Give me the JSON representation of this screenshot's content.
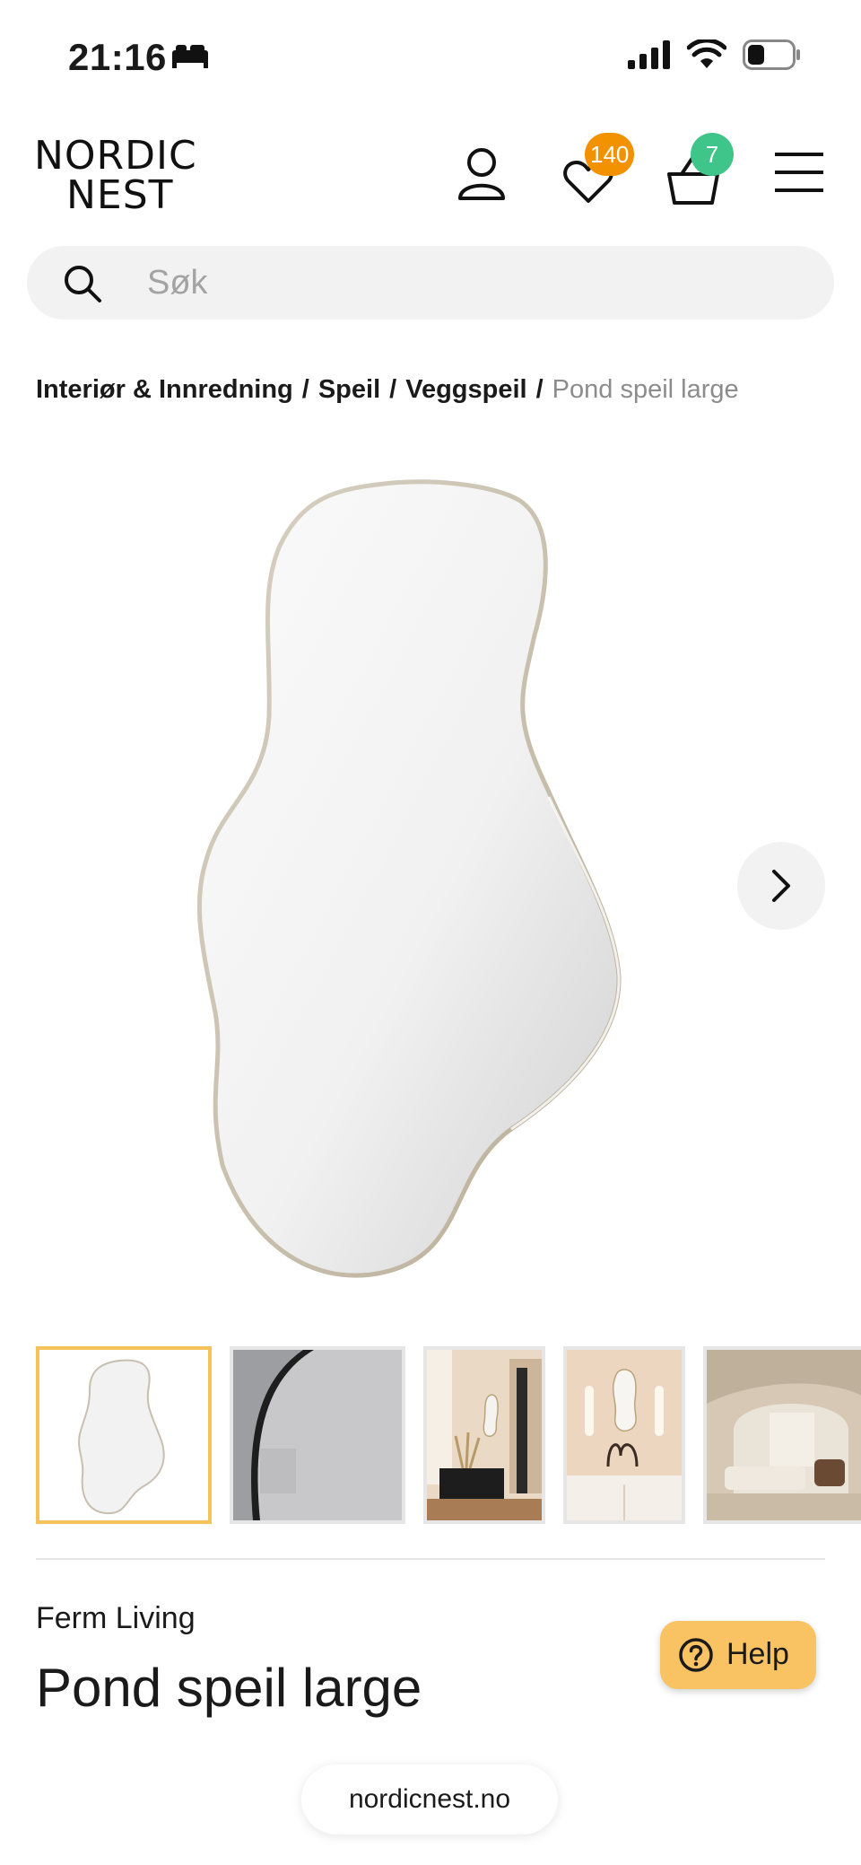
{
  "status_bar": {
    "time": "21:16"
  },
  "header": {
    "logo_line1": "NORDIC",
    "logo_line2": "NEST",
    "wishlist_count": "140",
    "cart_count": "7",
    "icons": [
      "user-icon",
      "heart-icon",
      "basket-icon",
      "menu-icon"
    ],
    "wishlist_badge_color": "#f39200",
    "cart_badge_color": "#3fc489"
  },
  "search": {
    "placeholder": "Søk"
  },
  "breadcrumb": {
    "items": [
      "Interiør & Innredning",
      "Speil",
      "Veggspeil"
    ],
    "separator": "/",
    "current": "Pond speil large"
  },
  "product": {
    "brand": "Ferm Living",
    "title": "Pond speil large",
    "thumbnail_count": 5,
    "active_thumbnail": 1
  },
  "help": {
    "label": "Help"
  },
  "browser": {
    "url": "nordicnest.no"
  },
  "colors": {
    "accent": "#f6c25c",
    "help_bg": "#f9c262"
  }
}
